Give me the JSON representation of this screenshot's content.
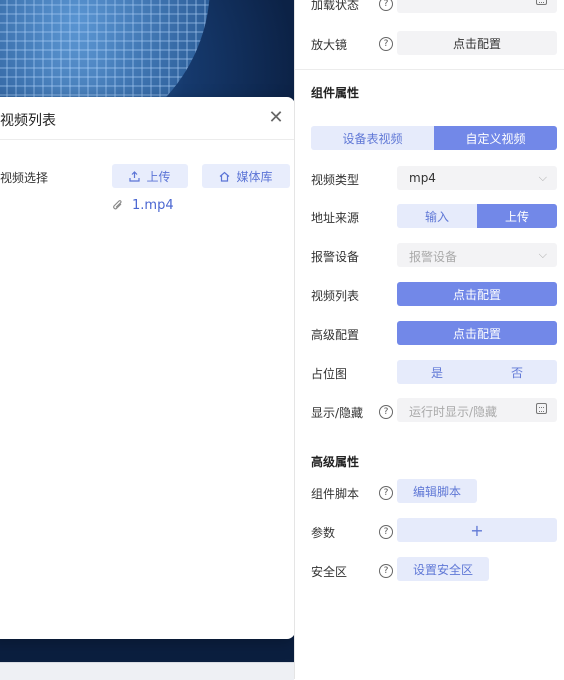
{
  "modal": {
    "title": "视频列表",
    "close_glyph": "✕",
    "field_label": "视频选择",
    "upload_label": "上传",
    "library_label": "媒体库",
    "file_name": "1.mp4"
  },
  "panel": {
    "load_state_label": "加载状态",
    "magnifier_label": "放大镜",
    "magnifier_button": "点击配置",
    "component_props_title": "组件属性",
    "source_tabs": [
      "设备表视频",
      "自定义视频"
    ],
    "video_type_label": "视频类型",
    "video_type_value": "mp4",
    "address_source_label": "地址来源",
    "address_source_options": [
      "输入",
      "上传"
    ],
    "alarm_device_label": "报警设备",
    "alarm_device_placeholder": "报警设备",
    "video_list_label": "视频列表",
    "video_list_button": "点击配置",
    "advanced_config_label": "高级配置",
    "advanced_config_button": "点击配置",
    "placeholder_label": "占位图",
    "placeholder_options": [
      "是",
      "否"
    ],
    "show_hide_label": "显示/隐藏",
    "show_hide_placeholder": "运行时显示/隐藏",
    "advanced_props_title": "高级属性",
    "script_label": "组件脚本",
    "script_button": "编辑脚本",
    "params_label": "参数",
    "params_button": "+",
    "safe_area_label": "安全区",
    "safe_area_button": "设置安全区",
    "help_glyph": "?"
  }
}
